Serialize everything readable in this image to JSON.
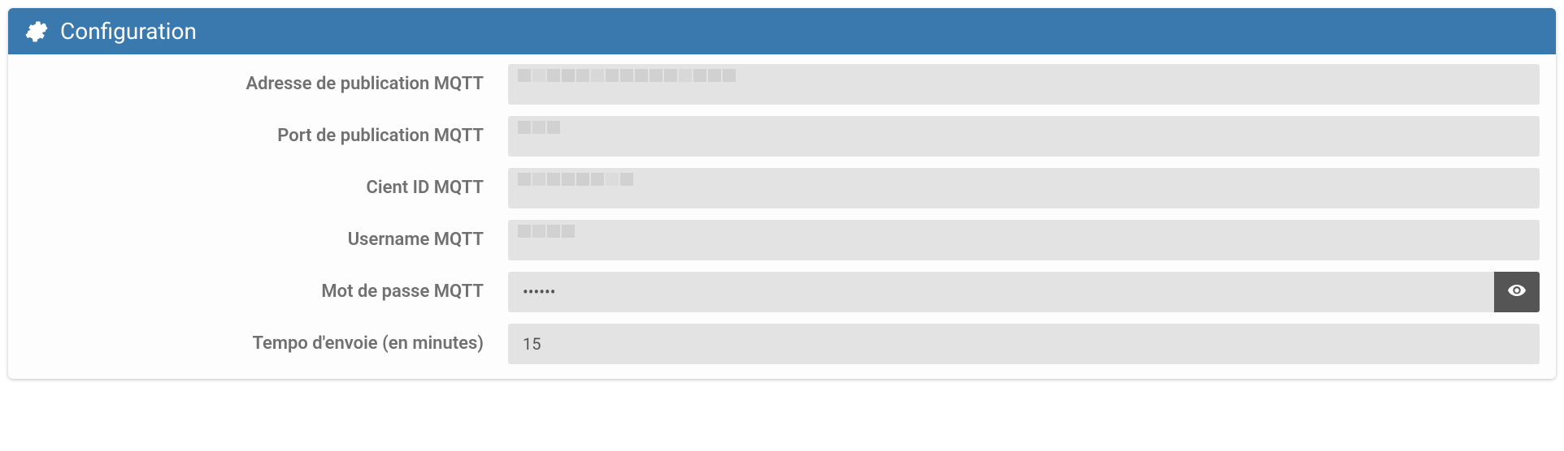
{
  "panel": {
    "title": "Configuration"
  },
  "fields": {
    "address": {
      "label": "Adresse de publication MQTT",
      "value": ""
    },
    "port": {
      "label": "Port de publication MQTT",
      "value": ""
    },
    "clientid": {
      "label": "Cient ID MQTT",
      "value": ""
    },
    "username": {
      "label": "Username MQTT",
      "value": ""
    },
    "password": {
      "label": "Mot de passe MQTT",
      "value": "••••••"
    },
    "tempo": {
      "label": "Tempo d'envoie (en minutes)",
      "value": "15"
    }
  },
  "icons": {
    "gears": "gears-icon",
    "eye": "eye-icon"
  }
}
